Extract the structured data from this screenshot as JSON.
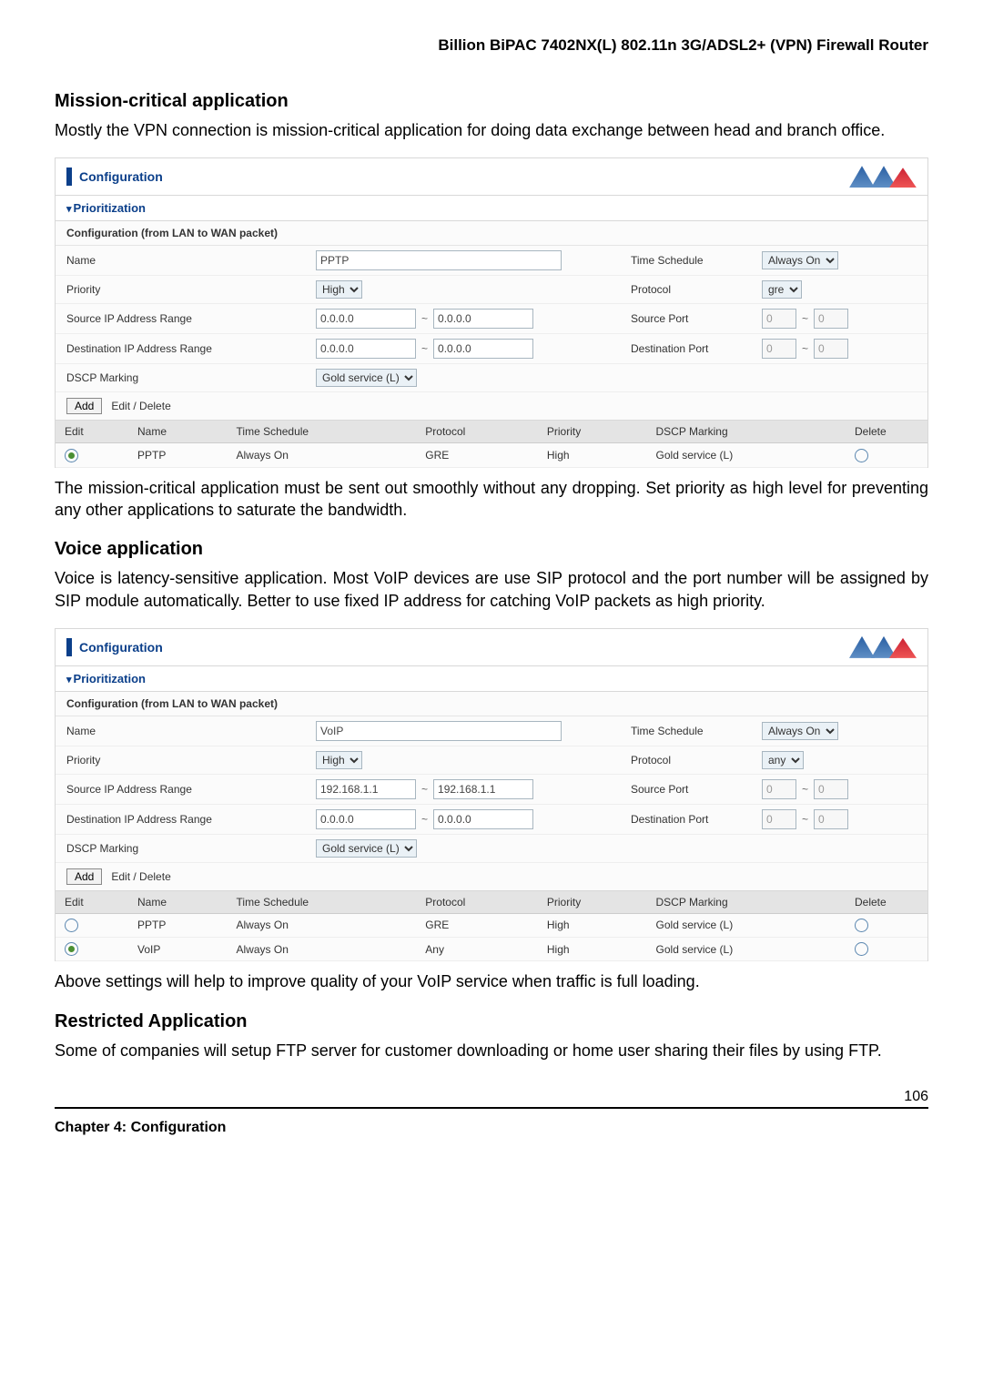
{
  "doc_header": "Billion BiPAC 7402NX(L) 802.11n 3G/ADSL2+ (VPN) Firewall Router",
  "s1": {
    "heading": "Mission-critical application",
    "para": "Mostly the VPN connection is mission-critical application for doing data exchange between head and branch office.",
    "after": "The mission-critical application must be sent out smoothly without any dropping. Set priority as high level for preventing any other applications to saturate the bandwidth."
  },
  "s2": {
    "heading": "Voice application",
    "para": "Voice is latency-sensitive application. Most VoIP devices are use SIP protocol and the port number will be assigned by SIP module automatically. Better to use fixed IP address for catching VoIP packets as high priority.",
    "after": "Above settings will help to improve quality of your VoIP service when traffic is full loading."
  },
  "s3": {
    "heading": "Restricted Application",
    "para": "Some of companies will setup FTP server for customer downloading or home user sharing their files by using FTP."
  },
  "panel": {
    "title": "Configuration",
    "section": "Prioritization",
    "sub": "Configuration (from LAN to WAN packet)",
    "labels": {
      "name": "Name",
      "time_schedule": "Time Schedule",
      "priority": "Priority",
      "protocol": "Protocol",
      "src_ip": "Source IP Address Range",
      "src_port": "Source Port",
      "dst_ip": "Destination IP Address Range",
      "dst_port": "Destination Port",
      "dscp": "DSCP Marking"
    },
    "add_btn": "Add",
    "edit_delete_text": "Edit / Delete",
    "table_headers": {
      "edit": "Edit",
      "name": "Name",
      "time_schedule": "Time Schedule",
      "protocol": "Protocol",
      "priority": "Priority",
      "dscp": "DSCP Marking",
      "delete": "Delete"
    }
  },
  "panel1": {
    "form": {
      "name": "PPTP",
      "time_schedule": "Always On",
      "priority": "High",
      "protocol": "gre",
      "src_ip_from": "0.0.0.0",
      "src_ip_to": "0.0.0.0",
      "src_port_from": "0",
      "src_port_to": "0",
      "dst_ip_from": "0.0.0.0",
      "dst_ip_to": "0.0.0.0",
      "dst_port_from": "0",
      "dst_port_to": "0",
      "dscp": "Gold service (L)"
    },
    "rows": [
      {
        "name": "PPTP",
        "time_schedule": "Always On",
        "protocol": "GRE",
        "priority": "High",
        "dscp": "Gold service (L)",
        "edit_checked": true
      }
    ]
  },
  "panel2": {
    "form": {
      "name": "VoIP",
      "time_schedule": "Always On",
      "priority": "High",
      "protocol": "any",
      "src_ip_from": "192.168.1.1",
      "src_ip_to": "192.168.1.1",
      "src_port_from": "0",
      "src_port_to": "0",
      "dst_ip_from": "0.0.0.0",
      "dst_ip_to": "0.0.0.0",
      "dst_port_from": "0",
      "dst_port_to": "0",
      "dscp": "Gold service (L)"
    },
    "rows": [
      {
        "name": "PPTP",
        "time_schedule": "Always On",
        "protocol": "GRE",
        "priority": "High",
        "dscp": "Gold service (L)",
        "edit_checked": false
      },
      {
        "name": "VoIP",
        "time_schedule": "Always On",
        "protocol": "Any",
        "priority": "High",
        "dscp": "Gold service (L)",
        "edit_checked": true
      }
    ]
  },
  "footer": {
    "chapter": "Chapter 4: Configuration",
    "page": "106"
  }
}
